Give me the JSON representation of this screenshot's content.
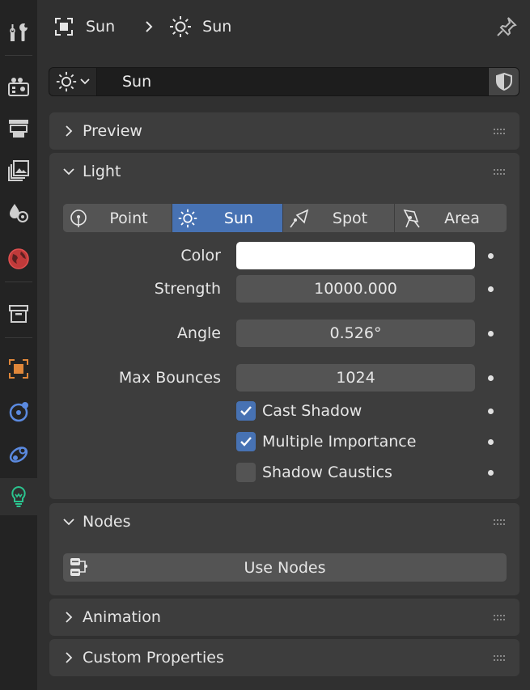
{
  "breadcrumb": {
    "object_name": "Sun",
    "data_name": "Sun"
  },
  "datablock": {
    "name": "Sun"
  },
  "panels": {
    "preview": {
      "title": "Preview"
    },
    "light": {
      "title": "Light",
      "types": [
        {
          "label": "Point"
        },
        {
          "label": "Sun"
        },
        {
          "label": "Spot"
        },
        {
          "label": "Area"
        }
      ],
      "active_type": "Sun",
      "color_label": "Color",
      "color_value": "#ffffff",
      "strength_label": "Strength",
      "strength_value": "10000.000",
      "angle_label": "Angle",
      "angle_value": "0.526°",
      "max_bounces_label": "Max Bounces",
      "max_bounces_value": "1024",
      "cast_shadow_label": "Cast Shadow",
      "cast_shadow_checked": true,
      "multiple_importance_label": "Multiple Importance",
      "multiple_importance_checked": true,
      "shadow_caustics_label": "Shadow Caustics",
      "shadow_caustics_checked": false
    },
    "nodes": {
      "title": "Nodes",
      "use_nodes_label": "Use Nodes"
    },
    "animation": {
      "title": "Animation"
    },
    "custom_properties": {
      "title": "Custom Properties"
    }
  },
  "colors": {
    "accent": "#4772b3",
    "panel_bg": "#3d3d3d",
    "editor_bg": "#303030",
    "tab_bg": "#232323",
    "widget_bg": "#545454"
  },
  "icons": {
    "tabs": [
      "tool-icon",
      "render-icon",
      "output-icon",
      "view-layer-icon",
      "scene-icon",
      "world-icon",
      "collection-icon",
      "object-icon",
      "physics-icon",
      "constraints-icon",
      "light-data-icon"
    ]
  }
}
